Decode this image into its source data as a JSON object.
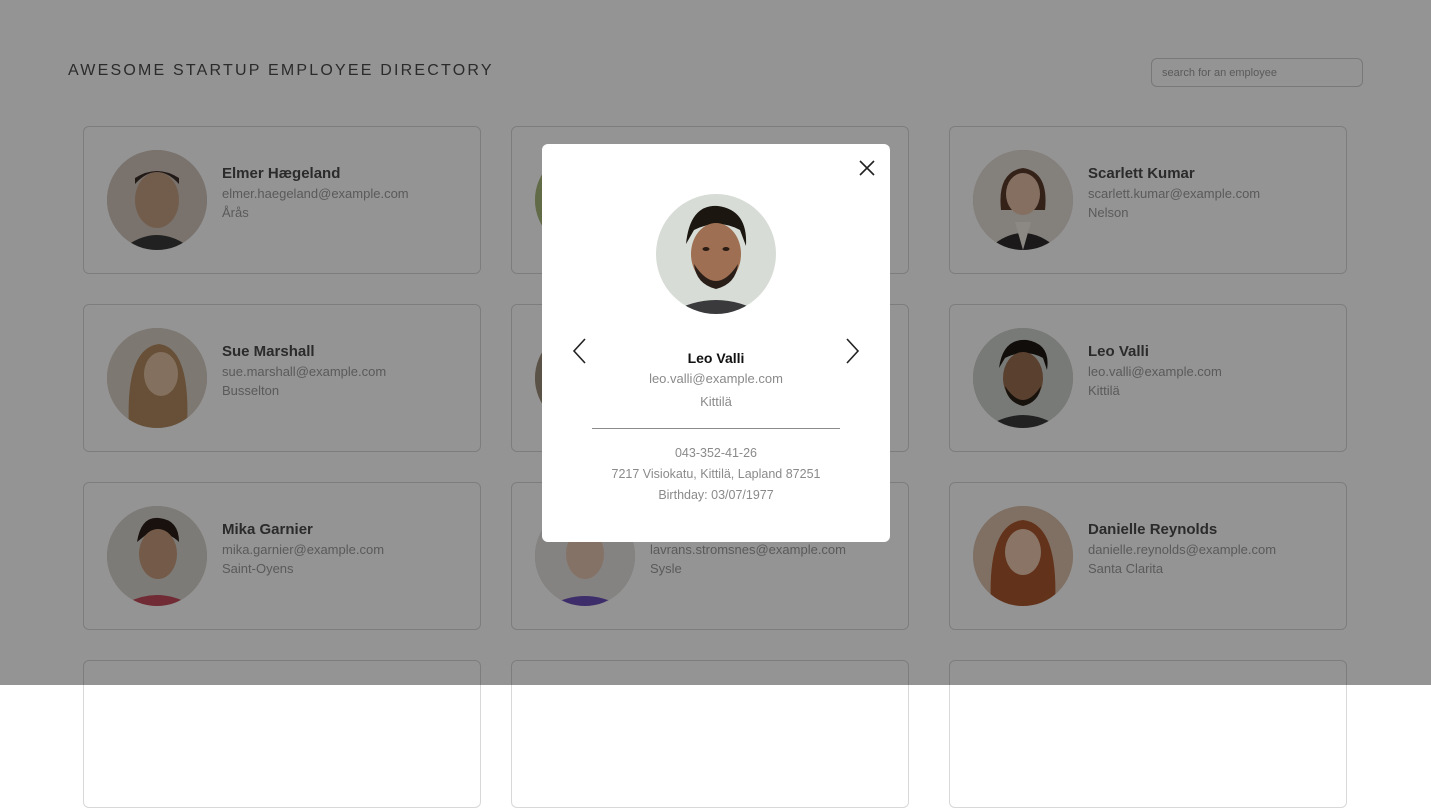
{
  "header": {
    "title": "AWESOME STARTUP EMPLOYEE DIRECTORY",
    "search_placeholder": "search for an employee",
    "search_value": ""
  },
  "employees": [
    {
      "name": "Elmer Hægeland",
      "email": "elmer.haegeland@example.com",
      "city": "Årås",
      "photo_color": "#c9b8a6"
    },
    {
      "name": "",
      "email": "",
      "city": "",
      "photo_color": "#a9b87a"
    },
    {
      "name": "Scarlett Kumar",
      "email": "scarlett.kumar@example.com",
      "city": "Nelson",
      "photo_color": "#d6c8be"
    },
    {
      "name": "Sue Marshall",
      "email": "sue.marshall@example.com",
      "city": "Busselton",
      "photo_color": "#c2a583"
    },
    {
      "name": "",
      "email": "",
      "city": "",
      "photo_color": "#9c8c7a"
    },
    {
      "name": "Leo Valli",
      "email": "leo.valli@example.com",
      "city": "Kittilä",
      "photo_color": "#7c6a5c"
    },
    {
      "name": "Mika Garnier",
      "email": "mika.garnier@example.com",
      "city": "Saint-Oyens",
      "photo_color": "#b79c86"
    },
    {
      "name": "",
      "email": "lavrans.stromsnes@example.com",
      "city": "Sysle",
      "photo_color": "#c9b6ad"
    },
    {
      "name": "Danielle Reynolds",
      "email": "danielle.reynolds@example.com",
      "city": "Santa Clarita",
      "photo_color": "#c79576"
    }
  ],
  "modal": {
    "name": "Leo Valli",
    "email": "leo.valli@example.com",
    "city": "Kittilä",
    "phone": "043-352-41-26",
    "address": "7217 Visiokatu, Kittilä, Lapland 87251",
    "birthday": "Birthday: 03/07/1977",
    "close_icon": "close-icon",
    "prev_icon": "chevron-left-icon",
    "next_icon": "chevron-right-icon"
  },
  "colors": {
    "overlay": "rgba(0,0,0,0.42)",
    "text_primary": "#4a4a4a",
    "text_secondary": "#9b9b9b"
  }
}
